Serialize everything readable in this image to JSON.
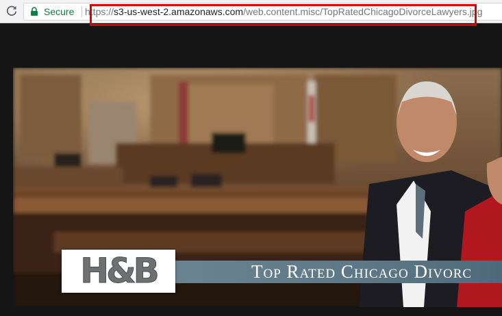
{
  "browser": {
    "security_label": "Secure",
    "url_scheme": "https://",
    "url_host": "s3-us-west-2.amazonaws.com",
    "url_path": "/web.content.misc/TopRatedChicagoDivorceLawyers.jpg"
  },
  "banner": {
    "logo_text": "H&B",
    "tagline": "Top Rated Chicago Divorc"
  },
  "colors": {
    "secure_green": "#0b8043",
    "highlight_red": "#e00000",
    "page_background": "#151515",
    "tagline_bar": "#5d7786"
  },
  "icons": {
    "reload": "reload-icon",
    "lock": "lock-icon"
  }
}
